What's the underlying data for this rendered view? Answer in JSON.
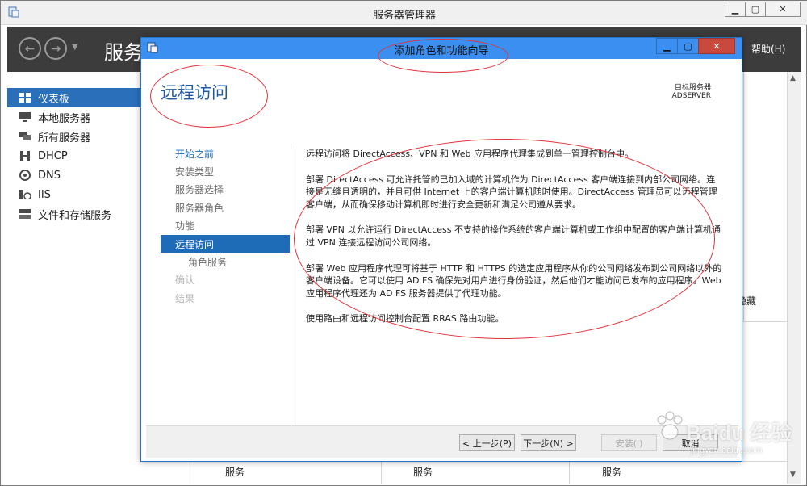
{
  "server_manager": {
    "title": "服务器管理器",
    "header_title": "服务",
    "help_menu": "帮助(H)",
    "sidebar": [
      {
        "label": "仪表板",
        "icon": "dashboard-icon",
        "active": true
      },
      {
        "label": "本地服务器",
        "icon": "server-icon"
      },
      {
        "label": "所有服务器",
        "icon": "servers-icon"
      },
      {
        "label": "DHCP",
        "icon": "dhcp-icon"
      },
      {
        "label": "DNS",
        "icon": "dns-icon"
      },
      {
        "label": "IIS",
        "icon": "iis-icon"
      },
      {
        "label": "文件和存储服务",
        "icon": "storage-icon"
      }
    ],
    "bottom_columns": [
      "服务",
      "服务",
      "服务"
    ],
    "hide_label": "隐藏"
  },
  "wizard": {
    "title": "添加角色和功能向导",
    "page_title": "远程访问",
    "target_server_label": "目标服务器",
    "target_server_value": "ADSERVER",
    "steps": [
      {
        "label": "开始之前",
        "state": "link"
      },
      {
        "label": "安装类型",
        "state": "normal"
      },
      {
        "label": "服务器选择",
        "state": "normal"
      },
      {
        "label": "服务器角色",
        "state": "normal"
      },
      {
        "label": "功能",
        "state": "normal"
      },
      {
        "label": "远程访问",
        "state": "active"
      },
      {
        "label": "角色服务",
        "state": "sub"
      },
      {
        "label": "确认",
        "state": "disabled"
      },
      {
        "label": "结果",
        "state": "disabled"
      }
    ],
    "paragraphs": [
      "远程访问将 DirectAccess、VPN 和 Web 应用程序代理集成到单一管理控制台中。",
      "部署 DirectAccess 可允许托管的已加入域的计算机作为 DirectAccess 客户端连接到内部公司网络。连接是无缝且透明的，并且可供 Internet 上的客户端计算机随时使用。DirectAccess 管理员可以远程管理客户端，从而确保移动计算机即时进行安全更新和满足公司遵从要求。",
      "部署 VPN 以允许运行 DirectAccess 不支持的操作系统的客户端计算机或工作组中配置的客户端计算机通过 VPN 连接远程访问公司网络。",
      "部署 Web 应用程序代理可将基于 HTTP 和 HTTPS 的选定应用程序从你的公司网络发布到公司网络以外的客户端设备。它可以使用 AD FS 确保先对用户进行身份验证，然后他们才能访问已发布的应用程序。Web 应用程序代理还为 AD FS 服务器提供了代理功能。",
      "使用路由和远程访问控制台配置 RRAS 路由功能。"
    ],
    "buttons": {
      "previous": "< 上一步(P)",
      "next": "下一步(N) >",
      "install": "安装(I)",
      "cancel": "取消"
    }
  },
  "watermark": {
    "text": "Baidu 经验",
    "url": "jingyan.baidu.com"
  },
  "colors": {
    "accent": "#2a6fba",
    "wizard_titlebar": "#3b8ff0",
    "annotation": "#e0323a"
  }
}
